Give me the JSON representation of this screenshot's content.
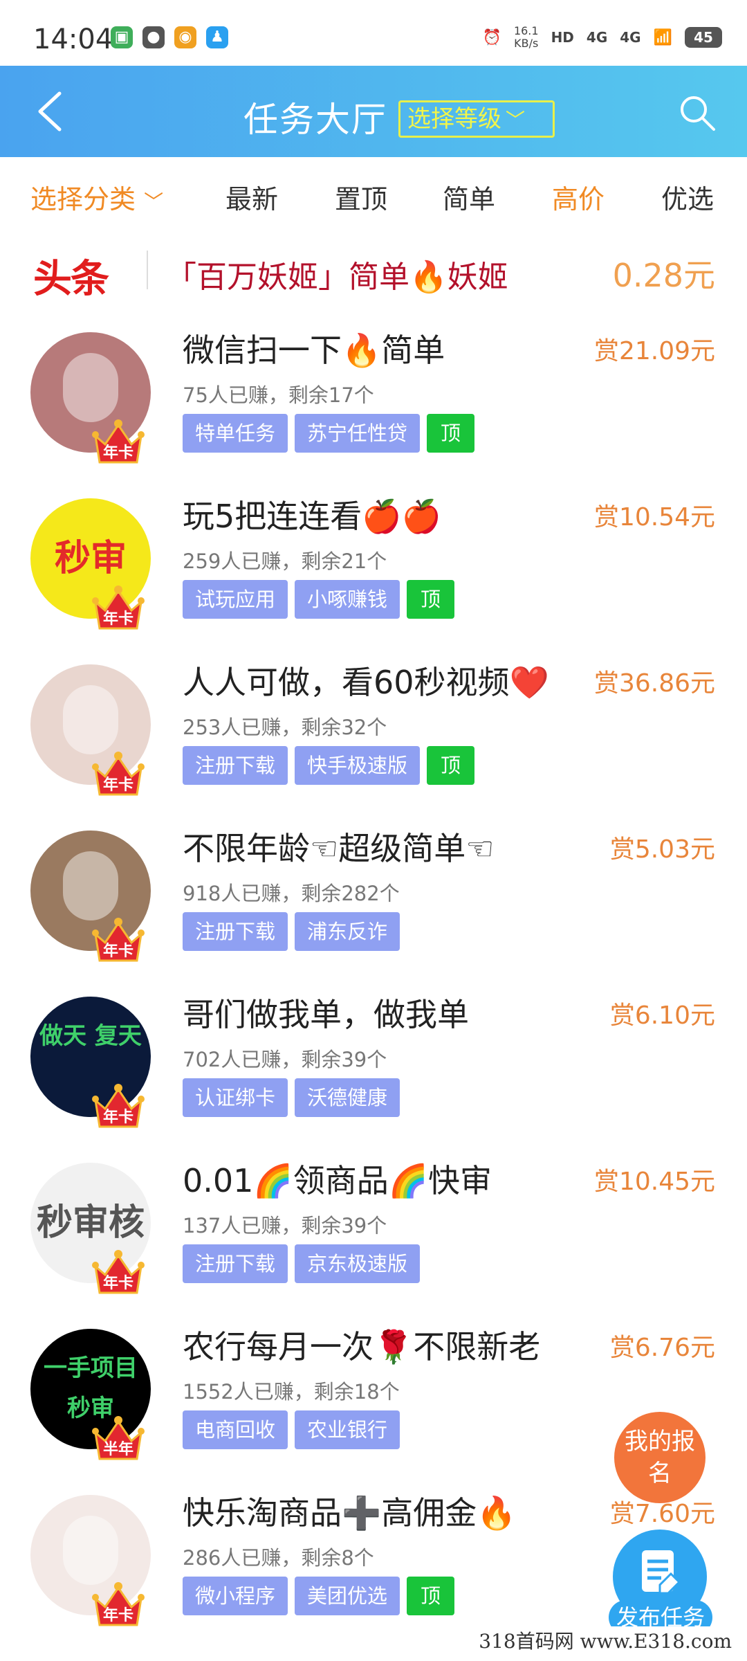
{
  "status_bar": {
    "time": "14:04",
    "speed_value": "16.1",
    "speed_unit": "KB/s",
    "network_1": "4G",
    "network_2": "4G",
    "battery": "45"
  },
  "header": {
    "title": "任务大厅",
    "level_select": "选择等级"
  },
  "filters": {
    "category": "选择分类",
    "items": [
      "最新",
      "置顶",
      "简单",
      "高价",
      "优选"
    ]
  },
  "headline": {
    "logo": "头条",
    "text": "「百万妖姬」简单🔥妖姬",
    "price": "0.28元"
  },
  "tasks": [
    {
      "title": "微信扫一下🔥简单",
      "stats": "75人已赚，剩余17个",
      "reward": "赏21.09元",
      "tags": [
        "特单任务",
        "苏宁任性贷"
      ],
      "top": "顶",
      "badge": "年卡",
      "avatar_text": "",
      "avatar_color": "#b77a7a"
    },
    {
      "title": "玩5把连连看🍎🍎",
      "stats": "259人已赚，剩余21个",
      "reward": "赏10.54元",
      "tags": [
        "试玩应用",
        "小啄赚钱"
      ],
      "top": "顶",
      "badge": "年卡",
      "avatar_text": "秒审",
      "avatar_color": "#f5e81a"
    },
    {
      "title": "人人可做，看60秒视频❤️",
      "stats": "253人已赚，剩余32个",
      "reward": "赏36.86元",
      "tags": [
        "注册下载",
        "快手极速版"
      ],
      "top": "顶",
      "badge": "年卡",
      "avatar_text": "",
      "avatar_color": "#e9d6cf"
    },
    {
      "title": "不限年龄☜超级简单☜",
      "stats": "918人已赚，剩余282个",
      "reward": "赏5.03元",
      "tags": [
        "注册下载",
        "浦东反诈"
      ],
      "top": "",
      "badge": "年卡",
      "avatar_text": "",
      "avatar_color": "#9a7a60"
    },
    {
      "title": "哥们做我单，做我单",
      "stats": "702人已赚，剩余39个",
      "reward": "赏6.10元",
      "tags": [
        "认证绑卡",
        "沃德健康"
      ],
      "top": "",
      "badge": "年卡",
      "avatar_text": "做天 复天",
      "avatar_color": "#0b1a3a"
    },
    {
      "title": "0.01🌈领商品🌈快审",
      "stats": "137人已赚，剩余39个",
      "reward": "赏10.45元",
      "tags": [
        "注册下载",
        "京东极速版"
      ],
      "top": "",
      "badge": "年卡",
      "avatar_text": "秒审核",
      "avatar_color": "#f1f1f1"
    },
    {
      "title": "农行每月一次🌹不限新老",
      "stats": "1552人已赚，剩余18个",
      "reward": "赏6.76元",
      "tags": [
        "电商回收",
        "农业银行"
      ],
      "top": "",
      "badge": "半年",
      "avatar_text": "一手项目 秒审",
      "avatar_color": "#000000"
    },
    {
      "title": "快乐淘商品➕高佣金🔥",
      "stats": "286人已赚，剩余8个",
      "reward": "赏7.60元",
      "tags": [
        "微小程序",
        "美团优选"
      ],
      "top": "顶",
      "badge": "年卡",
      "avatar_text": "",
      "avatar_color": "#f3e9e6"
    }
  ],
  "fab": {
    "signup": "我的报名",
    "publish": "发布任务"
  },
  "watermark": "318首码网 www.E318.com"
}
